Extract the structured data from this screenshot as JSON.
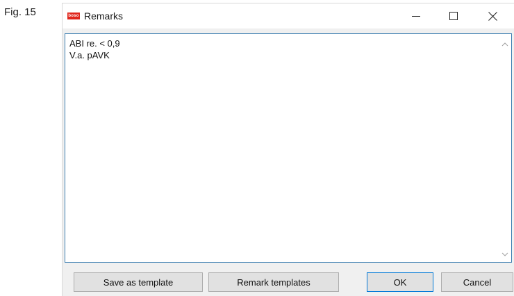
{
  "figure_label": "Fig. 15",
  "window": {
    "title": "Remarks",
    "app_icon_text": "boso",
    "controls": [
      "minimize",
      "maximize",
      "close"
    ]
  },
  "remarks": {
    "lines": [
      "ABI re. < 0,9",
      "V.a. pAVK"
    ]
  },
  "buttons": {
    "save_template": "Save as template",
    "remark_templates": "Remark templates",
    "ok": "OK",
    "cancel": "Cancel"
  },
  "icons": {
    "minimize": "minimize-icon",
    "maximize": "maximize-icon",
    "close": "close-icon",
    "scroll_up": "chevron-up-icon",
    "scroll_down": "chevron-down-icon"
  },
  "colors": {
    "app_icon": "#e0261c",
    "focus_border": "#3c7fb1",
    "default_button_border": "#0078d7"
  }
}
